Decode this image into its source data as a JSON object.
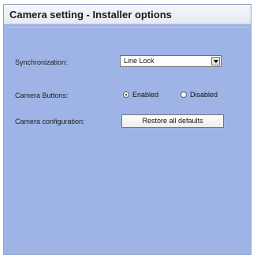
{
  "title": "Camera setting - Installer options",
  "synchronization": {
    "label": "Synchronization:",
    "selected": "Line Lock"
  },
  "camera_buttons": {
    "label": "Camera Buttons:",
    "options": [
      {
        "label": "Enabled",
        "checked": true
      },
      {
        "label": "Disabled",
        "checked": false
      }
    ]
  },
  "camera_configuration": {
    "label": "Camera configuration:",
    "button_label": "Restore all defaults"
  },
  "colors": {
    "panel_bg": "#9fb4e6",
    "title_bg": "#eef1f8"
  },
  "icons": {
    "dropdown": "chevron-down-icon"
  }
}
